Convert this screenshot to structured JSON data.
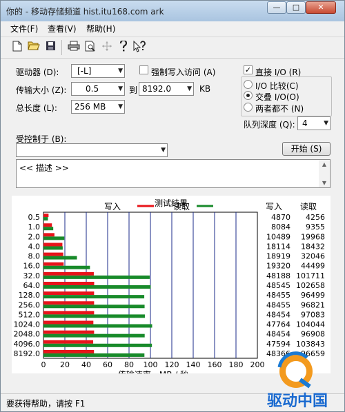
{
  "window": {
    "title": "你的 - 移动存储频道 hist.itu168.com   ark",
    "minimize": "—",
    "maximize": "□",
    "close": "✕"
  },
  "menu": {
    "file": "文件(F)",
    "view": "查看(V)",
    "help": "帮助(H)"
  },
  "toolbar": {
    "icons": [
      "new-icon",
      "open-icon",
      "save-icon",
      "print-icon",
      "print-preview-icon",
      "move-icon",
      "help-icon",
      "context-help-icon"
    ]
  },
  "form": {
    "drive_label": "驱动器 (D):",
    "drive_value": "[-L]",
    "force_write_label": "强制写入访问 (A)",
    "direct_io_label": "直接 I/O (R)",
    "transfer_size_label": "传输大小 (Z):",
    "transfer_from": "0.5",
    "to_label": "到",
    "transfer_to": "8192.0",
    "kb_unit": "KB",
    "total_length_label": "总长度 (L):",
    "total_length_value": "256 MB",
    "io_compare_label": "I/O 比较(C)",
    "overlapped_io_label": "交叠 I/O(O)",
    "neither_label": "两者都不 (N)",
    "queue_depth_label": "队列深度 (Q):",
    "queue_depth_value": "4",
    "controlled_by_label": "受控制于 (B):",
    "controlled_by_value": "",
    "start_button": "开始 (S)",
    "description": "<< 描述 >>"
  },
  "chart_data": {
    "type": "bar",
    "title": "测试结果",
    "legend": [
      "写入",
      "读取"
    ],
    "colors": {
      "write": "#e8141a",
      "read": "#188a2a",
      "grid": "#1a2a8a"
    },
    "categories": [
      "0.5",
      "1.0",
      "2.0",
      "4.0",
      "8.0",
      "16.0",
      "32.0",
      "64.0",
      "128.0",
      "256.0",
      "512.0",
      "1024.0",
      "2048.0",
      "4096.0",
      "8192.0"
    ],
    "series": [
      {
        "name": "写入",
        "values": [
          4870,
          8084,
          10489,
          18114,
          18919,
          19320,
          48188,
          48545,
          48455,
          48455,
          48454,
          47764,
          48454,
          47594,
          48366
        ]
      },
      {
        "name": "读取",
        "values": [
          4256,
          9355,
          19968,
          18432,
          32046,
          44499,
          101711,
          102658,
          96499,
          96821,
          97083,
          104044,
          96908,
          103843,
          96659
        ]
      }
    ],
    "write_col_header": "写入",
    "read_col_header": "读取",
    "write_values_text": [
      "4870",
      "8084",
      "10489",
      "18114",
      "18919",
      "19320",
      "48188",
      "48545",
      "48455",
      "48455",
      "48454",
      "47764",
      "48454",
      "47594",
      "48366"
    ],
    "read_values_text": [
      "4256",
      "9355",
      "19968",
      "18432",
      "32046",
      "44499",
      "101711",
      "102658",
      "96499",
      "96821",
      "97083",
      "104044",
      "96908",
      "103843",
      "96659"
    ],
    "xticks": [
      "0",
      "20",
      "40",
      "60",
      "80",
      "100",
      "120",
      "140",
      "160",
      "180",
      "200"
    ],
    "xmax": 200,
    "xlabel": "传输速率 - MB / 秒"
  },
  "status": {
    "text": "要获得帮助，请按 F1"
  },
  "watermark": {
    "text": "驱动中国"
  }
}
